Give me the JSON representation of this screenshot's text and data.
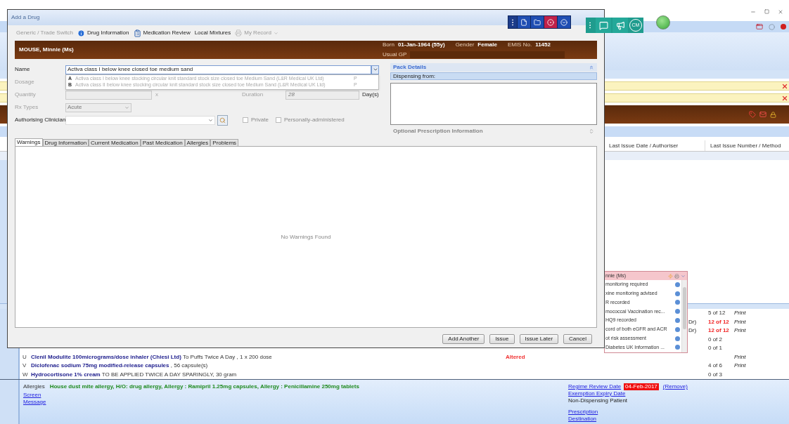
{
  "dialog": {
    "title": "Add a Drug",
    "toolbar": [
      {
        "label": "Generic / Trade Switch",
        "kind": "text",
        "disabled": true
      },
      {
        "label": "Drug Information",
        "kind": "info",
        "disabled": false
      },
      {
        "label": "Medication Review",
        "kind": "review",
        "disabled": false
      },
      {
        "label": "Local Mixtures",
        "kind": "text",
        "disabled": false
      },
      {
        "label": "My Record",
        "kind": "menu",
        "disabled": true
      }
    ],
    "patient": {
      "name": "MOUSE, Minnie (Ms)",
      "born_label": "Born",
      "born": "01-Jan-1964 (55y)",
      "gender_label": "Gender",
      "gender": "Female",
      "emis_label": "EMIS No.",
      "emis": "11452",
      "gp_label": "Usual GP"
    },
    "name_field": {
      "label": "Name",
      "value": "Activa class I below knee closed toe medium sand"
    },
    "suggestions": [
      {
        "key": "A",
        "text": "Activa class I below knee stocking circular knit standard stock size closed toe Medium Sand (L&R Medical UK Ltd)",
        "code": "P"
      },
      {
        "key": "B",
        "text": "Activa class II below knee stocking circular knit standard stock size closed toe Medium Sand (L&R Medical UK Ltd)",
        "code": "P"
      }
    ],
    "dosage_label": "Dosage",
    "quantity": {
      "label": "Quantity",
      "multiplier": "x"
    },
    "duration": {
      "label": "Duration",
      "value": "28",
      "unit": "Day(s)"
    },
    "rx_type": {
      "label": "Rx Types",
      "value": "Acute"
    },
    "clinician": {
      "label": "Authorising Clinician"
    },
    "checkboxes": [
      {
        "label": "Private",
        "checked": false
      },
      {
        "label": "Personally-administered",
        "checked": false
      }
    ],
    "pack": {
      "title": "Pack Details",
      "dispensing": "Dispensing from:",
      "optional": "Optional Prescription Information"
    },
    "tabs": [
      {
        "label": "Warnings",
        "selected": true
      },
      {
        "label": "Drug Information",
        "selected": false
      },
      {
        "label": "Current Medication",
        "selected": false
      },
      {
        "label": "Past Medication",
        "selected": false
      },
      {
        "label": "Allergies",
        "selected": false
      },
      {
        "label": "Problems",
        "selected": false
      }
    ],
    "empty_message": "No Warnings Found",
    "buttons": [
      "Add Another",
      "Issue",
      "Issue Later",
      "Cancel"
    ]
  },
  "cm_badge": "CM",
  "alert_popup": {
    "title": "nnie (Ms)",
    "items": [
      "monitoring required",
      "xine monitoring advised",
      "R recorded",
      "mococcal Vaccination rec...",
      "HQ9 recorded",
      "cord of both eGFR and ACR",
      "ot risk assessment",
      "Diabetes UK Information ..."
    ]
  },
  "background": {
    "columns": [
      "Last Issue Date / Authoriser",
      "Last Issue Number / Method"
    ],
    "rows": [
      {
        "issue": "5 of 12",
        "method": "Print",
        "overdue": false
      },
      {
        "authoriser": "Dr)",
        "issue": "12 of 12",
        "method": "Print",
        "overdue": true
      },
      {
        "authoriser": "Dr)",
        "issue": "12 of 12",
        "method": "Print",
        "overdue": true
      },
      {
        "issue": "0 of 2",
        "overdue": false
      },
      {
        "issue": "0 of 1",
        "overdue": false
      },
      {
        "letter": "U",
        "name": "Clenil Modulite 100micrograms/dose inhaler (Chiesi Ltd)",
        "detail": " To Puffs Twice A Day , 1 x 200 dose",
        "status": "Altered",
        "method": "Print"
      },
      {
        "letter": "V",
        "name": "Diclofenac sodium 75mg modified-release capsules",
        "detail": " , 56 capsule(s)",
        "issue": "4 of 6",
        "method": "Print",
        "overdue": false
      },
      {
        "letter": "W",
        "name": "Hydrocortisone 1% cream",
        "detail": " TO BE APPLIED TWICE A DAY SPARINGLY, 30 gram",
        "issue": "0 of 3",
        "overdue": false
      }
    ],
    "allergies_label": "Allergies",
    "allergies": "House dust mite allergy, H/O: drug allergy, Allergy : Ramipril 1.25mg capsules, Allergy : Penicillamine 250mg tablets",
    "links": [
      "Screen",
      "Message"
    ],
    "regime": {
      "label": "Regime Review Date",
      "date": "04-Feb-2017",
      "remove": "(Remove)"
    },
    "exemption": "Exemption Expiry Date",
    "dispensing_status": "Non-Dispensing Patient",
    "destination_links": [
      "Prescription",
      "Destination"
    ]
  }
}
